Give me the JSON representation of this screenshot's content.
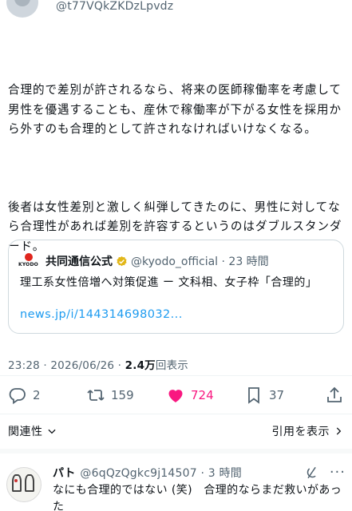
{
  "post": {
    "handle": "@t77VQkZKDzLpvdz",
    "paragraph_1": "合理的で差別が許されるなら、将来の医師稼働率を考慮して男性を優遇することも、産休で稼働率が下がる女性を採用から外すのも合理的として許されなければいけなくなる。",
    "paragraph_2": "後者は女性差別と激しく糾弾してきたのに、男性に対してなら合理性があれば差別を許容するというのはダブルスタンダード。"
  },
  "quote": {
    "logo_text": "KYODO",
    "name": "共同通信公式",
    "handle_time": "@kyodo_official · 23 時間",
    "text": "理工系女性倍増へ対策促進 ー 文科相、女子枠「合理的」",
    "link": "news.jp/i/144314698032..."
  },
  "meta": {
    "time_date": "23:28 · 2026/06/26 · ",
    "views_count": "2.4万",
    "views_label": "回表示"
  },
  "actions": {
    "reply_count": "2",
    "repost_count": "159",
    "like_count": "724",
    "bookmark_count": "37"
  },
  "related_label": "関連性",
  "show_quotes_label": "引用を表示",
  "reply": {
    "name": "パト",
    "handle_time": "@6qQzQgkc9j14507 · 3 時間",
    "more": "···",
    "text": "なにも合理的ではない (笑)　合理的ならまだ救いがあった"
  },
  "colors": {
    "text": "#0f1419",
    "secondary": "#536471",
    "link": "#1d9bf0",
    "like": "#f91880",
    "verified": "#e2b719",
    "kyodo_red": "#e0261e"
  }
}
